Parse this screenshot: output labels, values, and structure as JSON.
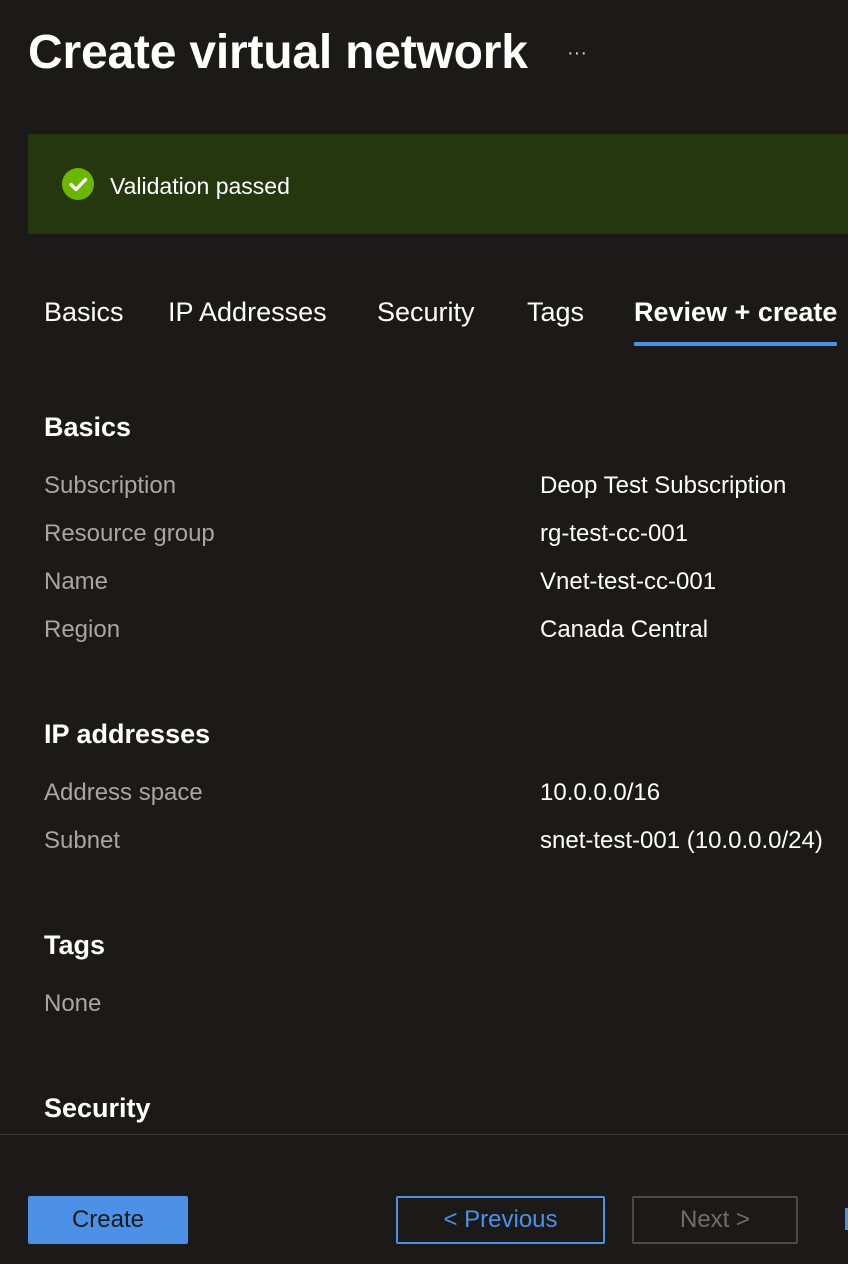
{
  "header": {
    "title": "Create virtual network",
    "more_label": "···"
  },
  "banner": {
    "message": "Validation passed",
    "icon": "check-circle-icon",
    "background": "#24370f",
    "icon_color": "#6bb700"
  },
  "tabs": [
    {
      "label": "Basics",
      "active": false
    },
    {
      "label": "IP Addresses",
      "active": false
    },
    {
      "label": "Security",
      "active": false
    },
    {
      "label": "Tags",
      "active": false
    },
    {
      "label": "Review + create",
      "active": true
    }
  ],
  "sections": {
    "basics": {
      "title": "Basics",
      "rows": [
        {
          "label": "Subscription",
          "value": "Deop Test Subscription"
        },
        {
          "label": "Resource group",
          "value": "rg-test-cc-001"
        },
        {
          "label": "Name",
          "value": "Vnet-test-cc-001"
        },
        {
          "label": "Region",
          "value": "Canada Central"
        }
      ]
    },
    "ip_addresses": {
      "title": "IP addresses",
      "rows": [
        {
          "label": "Address space",
          "value": "10.0.0.0/16"
        },
        {
          "label": "Subnet",
          "value": "snet-test-001 (10.0.0.0/24)"
        }
      ]
    },
    "tags": {
      "title": "Tags",
      "value": "None"
    },
    "security": {
      "title": "Security"
    }
  },
  "footer": {
    "create_label": "Create",
    "previous_label": "< Previous",
    "next_label": "Next >"
  },
  "colors": {
    "background": "#1b1a19",
    "accent": "#4c91e6",
    "muted_text": "#a6a6a6"
  }
}
